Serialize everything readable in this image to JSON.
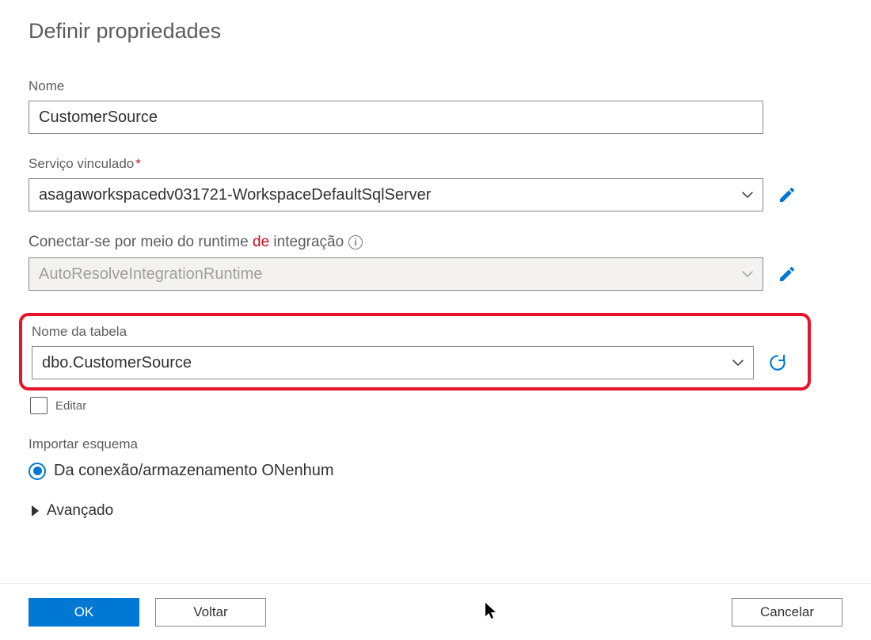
{
  "header": {
    "title": "Definir propriedades"
  },
  "name": {
    "label": "Nome",
    "value": "CustomerSource"
  },
  "linkedService": {
    "label": "Serviço vinculado",
    "required": "*",
    "value": "asagaworkspacedv031721-WorkspaceDefaultSqlServer"
  },
  "runtime": {
    "label_pre": "Conectar-se por meio do runtime ",
    "label_mid": "de",
    "label_post": " integração",
    "value": "AutoResolveIntegrationRuntime"
  },
  "table": {
    "label": "Nome da tabela",
    "value": "dbo.CustomerSource"
  },
  "edit": {
    "label": "Editar"
  },
  "schema": {
    "label": "Importar esquema",
    "option1": "Da conexão/armazenamento ONenhum"
  },
  "advanced": {
    "label": "Avançado"
  },
  "footer": {
    "ok": "OK",
    "back": "Voltar",
    "cancel": "Cancelar"
  }
}
